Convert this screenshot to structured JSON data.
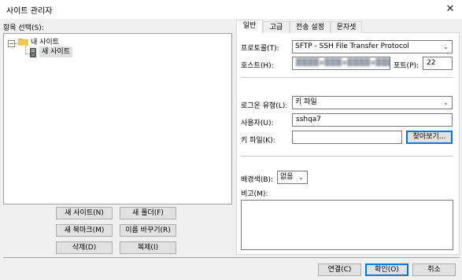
{
  "window": {
    "title": "사이트 관리자",
    "close_glyph": "✕"
  },
  "tree_panel": {
    "label": "항목 선택(S):",
    "expander_glyph": "−",
    "root_label": "내 사이트",
    "site_label": "새 사이트"
  },
  "left_buttons": {
    "new_site": "새 사이트(N)",
    "new_folder": "새 폴더(F)",
    "new_bookmark": "새 북마크(M)",
    "rename": "이름 바꾸기(R)",
    "delete": "삭제(D)",
    "duplicate": "복제(I)"
  },
  "tabs": [
    {
      "label": "일반",
      "active": true
    },
    {
      "label": "고급",
      "active": false
    },
    {
      "label": "전송 설정",
      "active": false
    },
    {
      "label": "문자셋",
      "active": false
    }
  ],
  "general": {
    "protocol_label": "프로토콜(T):",
    "protocol_value": "SFTP - SSH File Transfer Protocol",
    "host_label": "호스트(H):",
    "host_value": "████▪███▪████▪███",
    "port_label": "포트(P):",
    "port_value": "22",
    "logon_type_label": "로그온 유형(L):",
    "logon_type_value": "키 파일",
    "user_label": "사용자(U):",
    "user_value": "sshqa7",
    "keyfile_label": "키 파일(K):",
    "keyfile_value": "",
    "browse_button": "찾아보기...",
    "bg_color_label": "배경색(B):",
    "bg_color_value": "없음",
    "comments_label": "비고(M):",
    "comments_value": "",
    "dropdown_glyph": "⌄"
  },
  "dialog_buttons": {
    "connect": "연결(C)",
    "ok": "확인(O)",
    "cancel": "취소"
  },
  "colors": {
    "folder": "#e8b84a",
    "server": "#555555",
    "focus_border": "#0078d7"
  }
}
